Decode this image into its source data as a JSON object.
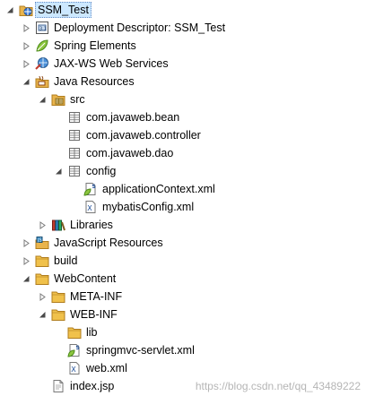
{
  "colors": {
    "folder": "#e9b44c",
    "folder_dark": "#b07d1e",
    "package": "#6a6a6a",
    "selection": "#cce8ff"
  },
  "tree": {
    "items": [
      {
        "label": "SSM_Test",
        "depth": 0,
        "toggle": "expanded",
        "icon": "web-project-icon",
        "selected": true
      },
      {
        "label": "Deployment Descriptor: SSM_Test",
        "depth": 1,
        "toggle": "collapsed",
        "icon": "deployment-descriptor-icon"
      },
      {
        "label": "Spring Elements",
        "depth": 1,
        "toggle": "collapsed",
        "icon": "spring-leaf-icon"
      },
      {
        "label": "JAX-WS Web Services",
        "depth": 1,
        "toggle": "collapsed",
        "icon": "web-services-icon"
      },
      {
        "label": "Java Resources",
        "depth": 1,
        "toggle": "expanded",
        "icon": "java-resources-icon"
      },
      {
        "label": "src",
        "depth": 2,
        "toggle": "expanded",
        "icon": "source-folder-icon"
      },
      {
        "label": "com.javaweb.bean",
        "depth": 3,
        "toggle": "none",
        "icon": "package-icon"
      },
      {
        "label": "com.javaweb.controller",
        "depth": 3,
        "toggle": "none",
        "icon": "package-icon"
      },
      {
        "label": "com.javaweb.dao",
        "depth": 3,
        "toggle": "none",
        "icon": "package-icon"
      },
      {
        "label": "config",
        "depth": 3,
        "toggle": "expanded",
        "icon": "package-icon"
      },
      {
        "label": "applicationContext.xml",
        "depth": 4,
        "toggle": "none",
        "icon": "spring-xml-icon"
      },
      {
        "label": "mybatisConfig.xml",
        "depth": 4,
        "toggle": "none",
        "icon": "xml-file-icon"
      },
      {
        "label": "Libraries",
        "depth": 2,
        "toggle": "collapsed",
        "icon": "libraries-icon"
      },
      {
        "label": "JavaScript Resources",
        "depth": 1,
        "toggle": "collapsed",
        "icon": "javascript-resources-icon"
      },
      {
        "label": "build",
        "depth": 1,
        "toggle": "collapsed",
        "icon": "folder-icon"
      },
      {
        "label": "WebContent",
        "depth": 1,
        "toggle": "expanded",
        "icon": "folder-icon"
      },
      {
        "label": "META-INF",
        "depth": 2,
        "toggle": "collapsed",
        "icon": "folder-icon"
      },
      {
        "label": "WEB-INF",
        "depth": 2,
        "toggle": "expanded",
        "icon": "folder-icon"
      },
      {
        "label": "lib",
        "depth": 3,
        "toggle": "none",
        "icon": "folder-icon"
      },
      {
        "label": "springmvc-servlet.xml",
        "depth": 3,
        "toggle": "none",
        "icon": "spring-xml-icon"
      },
      {
        "label": "web.xml",
        "depth": 3,
        "toggle": "none",
        "icon": "xml-file-icon"
      },
      {
        "label": "index.jsp",
        "depth": 2,
        "toggle": "none",
        "icon": "jsp-file-icon"
      }
    ]
  },
  "watermark": "https://blog.csdn.net/qq_43489222"
}
